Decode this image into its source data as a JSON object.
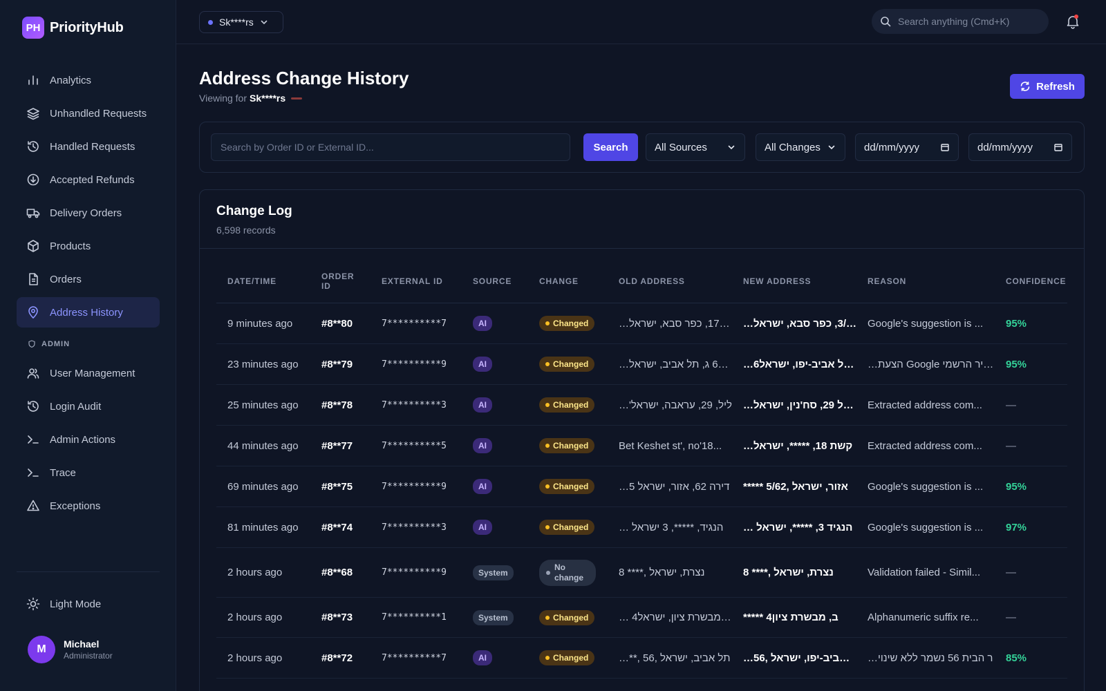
{
  "brand": {
    "logo": "PH",
    "name": "PriorityHub"
  },
  "nav": [
    {
      "label": "Analytics",
      "icon": "bar-chart-icon"
    },
    {
      "label": "Unhandled Requests",
      "icon": "layers-icon"
    },
    {
      "label": "Handled Requests",
      "icon": "history-icon"
    },
    {
      "label": "Accepted Refunds",
      "icon": "download-circle-icon"
    },
    {
      "label": "Delivery Orders",
      "icon": "truck-icon"
    },
    {
      "label": "Products",
      "icon": "box-icon"
    },
    {
      "label": "Orders",
      "icon": "document-icon"
    },
    {
      "label": "Address History",
      "icon": "map-pin-icon",
      "active": true
    }
  ],
  "admin_section": {
    "label": "ADMIN",
    "items": [
      {
        "label": "User Management",
        "icon": "users-icon"
      },
      {
        "label": "Login Audit",
        "icon": "history-icon"
      },
      {
        "label": "Admin Actions",
        "icon": "terminal-icon"
      },
      {
        "label": "Trace",
        "icon": "terminal-icon"
      },
      {
        "label": "Exceptions",
        "icon": "warning-icon"
      }
    ]
  },
  "theme_toggle": "Light Mode",
  "user": {
    "initial": "M",
    "name": "Michael",
    "role": "Administrator"
  },
  "topbar": {
    "tenant": "Sk****rs",
    "search_placeholder": "Search anything (Cmd+K)"
  },
  "page": {
    "title": "Address Change History",
    "viewing_for_label": "Viewing for",
    "viewing_for_value": "Sk****rs",
    "refresh_label": "Refresh"
  },
  "filters": {
    "search_placeholder": "Search by Order ID or External ID...",
    "search_button": "Search",
    "source_select": "All Sources",
    "change_select": "All Changes",
    "date_from": "dd/mm/yyyy",
    "date_to": "dd/mm/yyyy"
  },
  "table": {
    "title": "Change Log",
    "record_count": "6,598 records",
    "columns": [
      "DATE/TIME",
      "ORDER ID",
      "EXTERNAL ID",
      "SOURCE",
      "CHANGE",
      "OLD ADDRESS",
      "NEW ADDRESS",
      "REASON",
      "CONFIDENCE"
    ],
    "rows": [
      {
        "time": "9 minutes ago",
        "order": "#8**80",
        "ext": "7**********7",
        "source": "AI",
        "change": "Changed",
        "old": "…ירה 17, כפר סבא, ישראל",
        "new": "…י 3/17, כפר סבא, ישראל",
        "reason": "Google's suggestion is ...",
        "confidence": "95%"
      },
      {
        "time": "23 minutes ago",
        "order": "#8**79",
        "ext": "7**********9",
        "source": "AI",
        "change": "Changed",
        "old": "…י, 60 ג, תל אביב, ישראל",
        "new": "…6ג, תל אביב-יפו, ישראל",
        "reason": "…הצעת Google העיר הרשמי",
        "confidence": "95%"
      },
      {
        "time": "25 minutes ago",
        "order": "#8**78",
        "ext": "7**********3",
        "source": "AI",
        "change": "Changed",
        "old": "…'ליל, 29, עראבה, ישראל",
        "new": "…ג'ליל 29, סח'נין, ישראל",
        "reason": "Extracted address com...",
        "confidence": "—"
      },
      {
        "time": "44 minutes ago",
        "order": "#8**77",
        "ext": "7**********5",
        "source": "AI",
        "change": "Changed",
        "old": "Bet Keshet st', no'18...",
        "new": "…קשת 18, *****, ישראל",
        "reason": "Extracted address com...",
        "confidence": "—"
      },
      {
        "time": "69 minutes ago",
        "order": "#8**75",
        "ext": "7**********9",
        "source": "AI",
        "change": "Changed",
        "old": "…5 דירה 62, אזור, ישראל",
        "new": "***** 5/62, אזור, ישראל",
        "reason": "Google's suggestion is ...",
        "confidence": "95%"
      },
      {
        "time": "81 minutes ago",
        "order": "#8**74",
        "ext": "7**********3",
        "source": "AI",
        "change": "Changed",
        "old": "… הנגיד, *****, 3 ישראל",
        "new": "… הנגיד 3, *****, ישראל",
        "reason": "Google's suggestion is ...",
        "confidence": "97%"
      },
      {
        "time": "2 hours ago",
        "order": "#8**68",
        "ext": "7**********9",
        "source": "System",
        "change": "No change",
        "old": "8 ****, נצרת, ישראל",
        "new": "8 ****, נצרת, ישראל",
        "reason": "Validation failed - Simil...",
        "confidence": "—"
      },
      {
        "time": "2 hours ago",
        "order": "#8**73",
        "ext": "7**********1",
        "source": "System",
        "change": "Changed",
        "old": "… 4ב, מבשרת ציון, ישראל",
        "new": "***** 4ב, מבשרת ציון",
        "reason": "Alphanumeric suffix re...",
        "confidence": "—"
      },
      {
        "time": "2 hours ago",
        "order": "#8**72",
        "ext": "7**********7",
        "source": "AI",
        "change": "Changed",
        "old": "…**, 56, תל אביב, ישראל",
        "new": "…56, תל אביב-יפו, ישראל",
        "reason": "…ר הבית 56 נשמר ללא שינוי",
        "confidence": "85%"
      }
    ]
  }
}
